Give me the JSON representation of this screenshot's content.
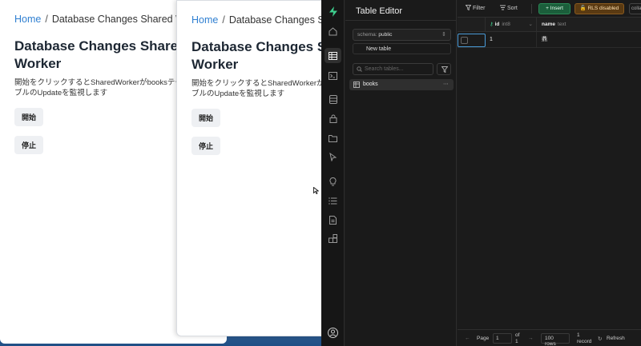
{
  "browser_window": {
    "breadcrumb_home": "Home",
    "breadcrumb_sep": "/",
    "breadcrumb_current": "Database Changes Shared Worker",
    "heading": "Database Changes Shared Worker",
    "description_1": "開始をクリックするとSharedWorkerがbooksテーブルのUpdateを監視します",
    "description_2": "開始をクリックするとSharedWorkerがbooksテーブルのUpdateを監視します",
    "start_label": "開始",
    "stop_label": "停止"
  },
  "studio": {
    "sidebar_title": "Table Editor",
    "schema_label": "schema:",
    "schema_value": "public",
    "new_table_label": "New table",
    "search_placeholder": "Search tables...",
    "tables": [
      {
        "name": "books"
      }
    ],
    "toolbar": {
      "filter_label": "Filter",
      "sort_label": "Sort",
      "insert_label": "Insert",
      "rls_label": "RLS disabled",
      "collab_label": "colla"
    },
    "columns": [
      {
        "name": "id",
        "type": "int8"
      },
      {
        "name": "name",
        "type": "text"
      }
    ],
    "rows": [
      {
        "id": "1",
        "name": "鼎"
      }
    ],
    "footer": {
      "page_label": "Page",
      "page_value": "1",
      "of_label": "of",
      "page_total": "1",
      "rows_label": "100 rows",
      "record_count": "1",
      "record_label": "record",
      "refresh_label": "Refresh"
    }
  },
  "colors": {
    "accent_green": "#3ecf8e",
    "insert_bg": "#1b5e3b",
    "rls_bg": "#5a3a12",
    "link_blue": "#2f7fd1"
  }
}
